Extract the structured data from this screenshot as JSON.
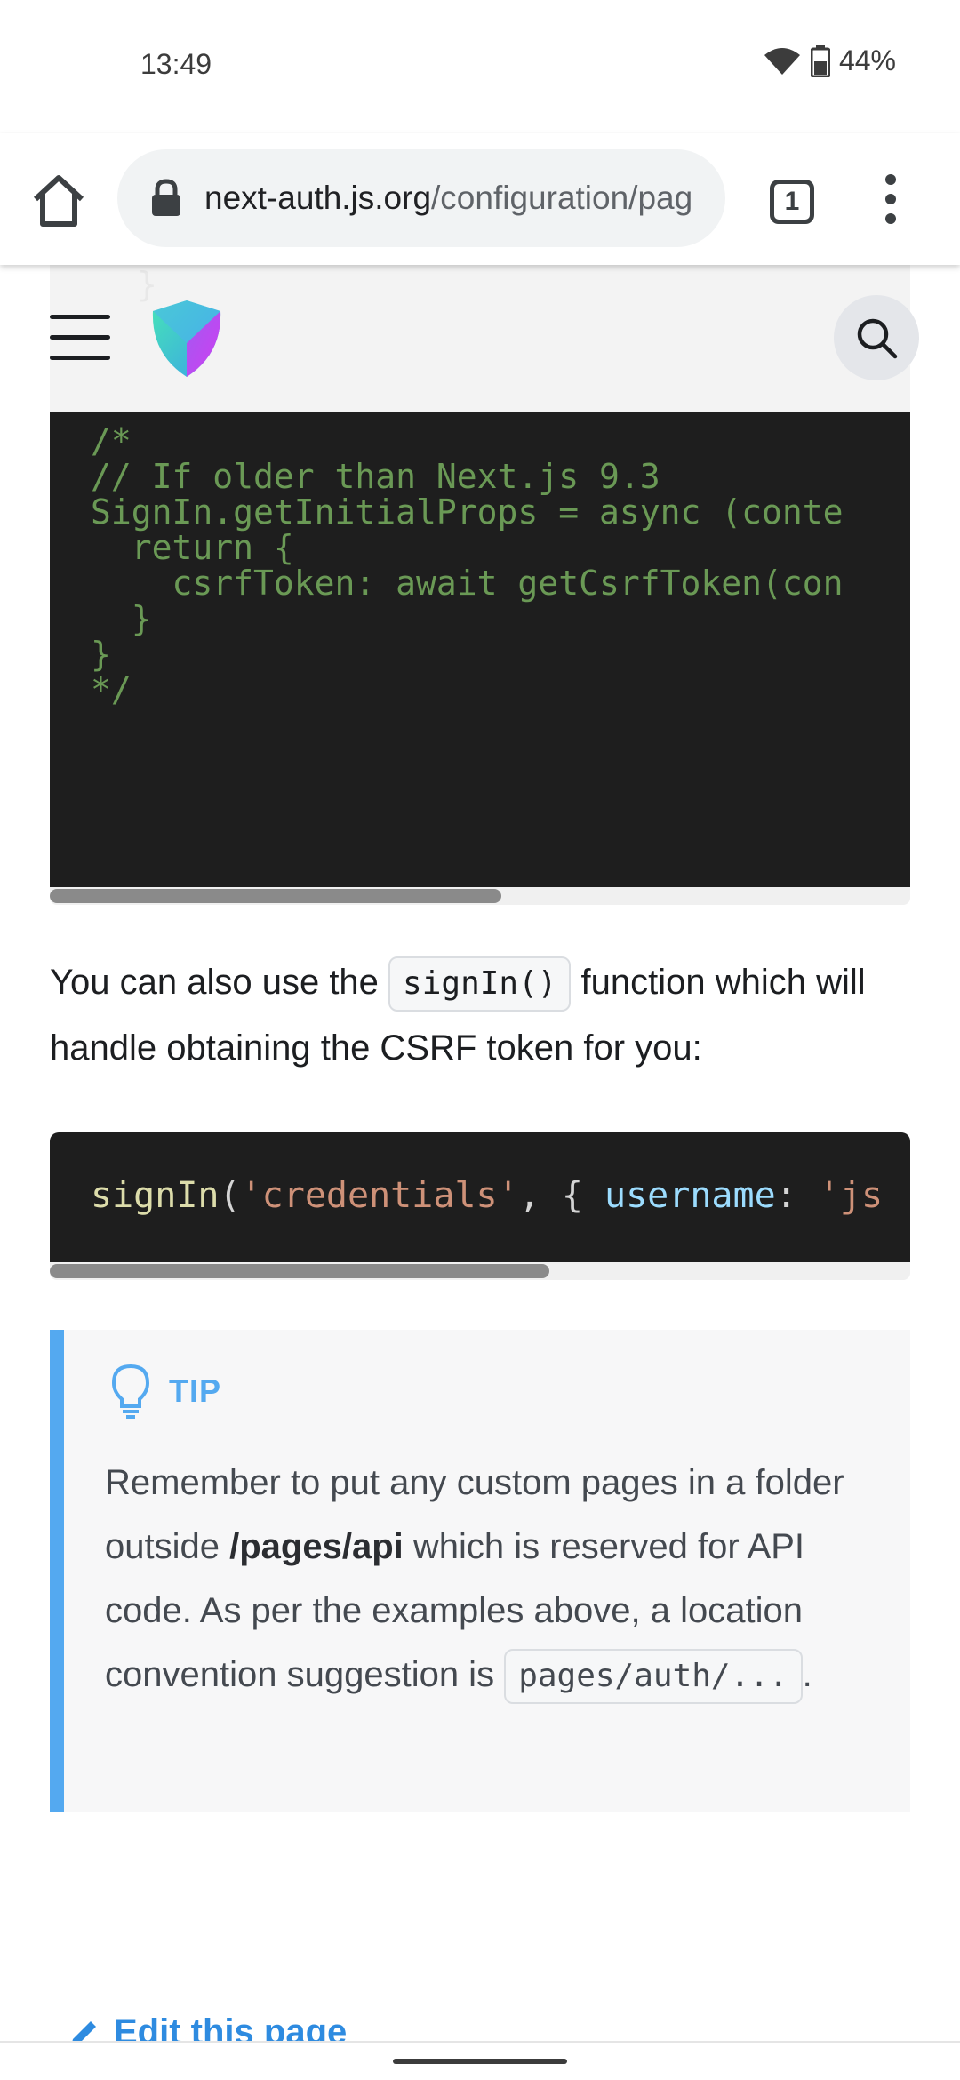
{
  "status_bar": {
    "time": "13:49",
    "battery_percent": "44%",
    "icons": [
      "wifi-icon",
      "battery-icon"
    ]
  },
  "browser": {
    "url_domain": "next-auth.js.org",
    "url_path": "/configuration/pag",
    "tab_count": "1",
    "icons": [
      "home-icon",
      "lock-icon",
      "tabs-icon",
      "more-vert-icon"
    ]
  },
  "site_nav": {
    "ghost_brace": "}",
    "icons": [
      "hamburger-menu-icon",
      "shield-logo-icon",
      "search-icon"
    ],
    "accent": "#54a9f0"
  },
  "code_block_1": {
    "lines": [
      "/*",
      "// If older than Next.js 9.3",
      "SignIn.getInitialProps = async (conte",
      "  return {",
      "    csrfToken: await getCsrfToken(con",
      "  }",
      "}",
      "*/"
    ]
  },
  "paragraph": {
    "before": "You can also use the ",
    "code": "signIn()",
    "after": " function which will handle obtaining the CSRF token for you:"
  },
  "code_block_2": {
    "fn": "signIn",
    "open": "(",
    "str1": "'credentials'",
    "mid": ", { ",
    "prop": "username",
    "colon": ": ",
    "str2": "'js"
  },
  "tip": {
    "label": "TIP",
    "text_1": "Remember to put any custom pages in a folder outside ",
    "bold": "/pages/api",
    "text_2": " which is reserved for API code. As per the examples above, a location convention suggestion is ",
    "code": "pages/auth/...",
    "text_3": "."
  },
  "footer": {
    "edit_label": "Edit this page"
  }
}
